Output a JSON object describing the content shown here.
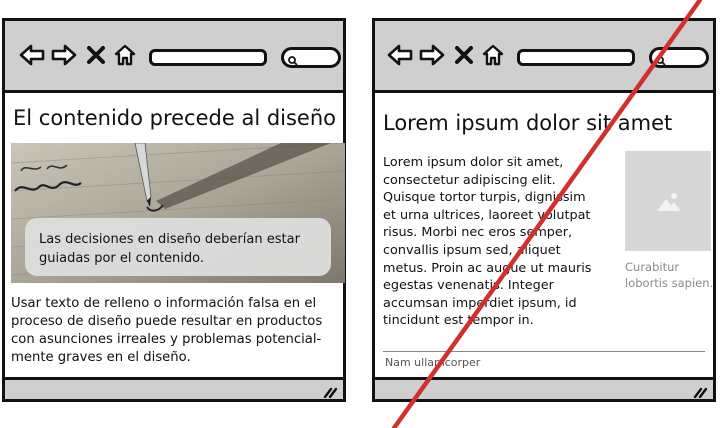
{
  "left_window": {
    "title": "El contenido precede al diseño",
    "callout": "Las decisiones en diseño deberían estar guiadas por el contenido.",
    "body_lines": [
      "Usar texto de relleno o información falsa en el",
      "proceso de diseño puede resultar en productos",
      "con asunciones irreales y problemas potencial-",
      "mente graves en el diseño."
    ]
  },
  "right_window": {
    "title": "Lorem ipsum dolor sit amet",
    "body_lines": [
      "Lorem ipsum dolor sit amet,",
      "consectetur adipiscing elit.",
      "Quisque tortor turpis, dignissim",
      "et urna ultrices, laoreet volutpat",
      "risus. Morbi nec eros semper,",
      "convallis ipsum sed, aliquet",
      "metus. Proin ac augue ut mauris",
      "egestas venenatis. Integer",
      "accumsan imperdiet ipsum, id",
      "tincidunt est tempor in."
    ],
    "caption_lines": [
      "Curabitur",
      "lobortis sapien."
    ],
    "footer": "Nam ullamcorper"
  },
  "icons": {
    "back": "back-arrow-icon",
    "forward": "forward-arrow-icon",
    "stop": "close-icon",
    "home": "home-icon",
    "search": "search-icon",
    "grip": "resize-grip-icon",
    "placeholder": "image-placeholder-icon"
  },
  "colors": {
    "chrome": "#cfcfcf",
    "outline": "#111111",
    "strike": "#d0312d",
    "placeholder": "#d6d6d6",
    "caption": "#8a8a8a"
  }
}
